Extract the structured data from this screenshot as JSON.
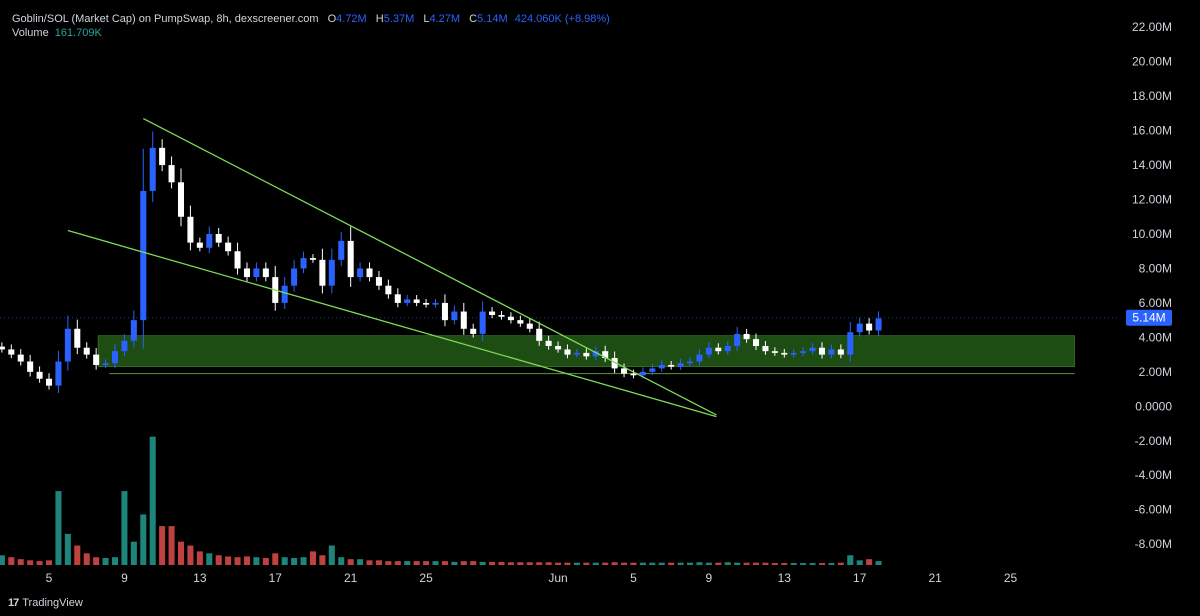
{
  "header": {
    "symbol": "Goblin/SOL (Market Cap) on PumpSwap, 8h, dexscreener.com",
    "o_label": "O",
    "o_value": "4.72M",
    "h_label": "H",
    "h_value": "5.37M",
    "l_label": "L",
    "l_value": "4.27M",
    "c_label": "C",
    "c_value": "5.14M",
    "change": "424.060K (+8.98%)",
    "volume_label": "Volume",
    "volume_value": "161.709K"
  },
  "footer": {
    "brand": "TradingView",
    "logo": "17"
  },
  "colors": {
    "background": "#000000",
    "up": "#2962ff",
    "down": "#ffffff",
    "vol_up": "#26a69a",
    "vol_down": "#ef5350",
    "trendline": "#7ed957",
    "zone_fill": "#1e4d14",
    "last_price_bg": "#2962ff"
  },
  "chart_data": {
    "type": "candlestick",
    "last_price": "5.14M",
    "y_ticks": [
      "22.00M",
      "20.00M",
      "18.00M",
      "16.00M",
      "14.00M",
      "12.00M",
      "10.00M",
      "8.00M",
      "6.00M",
      "4.00M",
      "2.00M",
      "0.0000",
      "-2.00M",
      "-4.00M",
      "-6.00M",
      "-8.00M"
    ],
    "x_ticks": [
      {
        "label": "5",
        "day": 5
      },
      {
        "label": "9",
        "day": 9
      },
      {
        "label": "13",
        "day": 13
      },
      {
        "label": "17",
        "day": 17
      },
      {
        "label": "21",
        "day": 21
      },
      {
        "label": "25",
        "day": 25
      },
      {
        "label": "Jun",
        "day": 32
      },
      {
        "label": "5",
        "day": 36
      },
      {
        "label": "9",
        "day": 40
      },
      {
        "label": "13",
        "day": 44
      },
      {
        "label": "17",
        "day": 48
      },
      {
        "label": "21",
        "day": 52
      },
      {
        "label": "25",
        "day": 56
      }
    ],
    "ylim": [
      -9.5,
      23
    ],
    "xlim": [
      2.4,
      61.7
    ],
    "price_path": [
      [
        2.5,
        3.3
      ],
      [
        3.0,
        3.0
      ],
      [
        3.5,
        2.6
      ],
      [
        4.0,
        2.0
      ],
      [
        4.5,
        1.6
      ],
      [
        5.0,
        1.2
      ],
      [
        5.5,
        2.6
      ],
      [
        6.0,
        4.5
      ],
      [
        6.5,
        3.4
      ],
      [
        7.0,
        3.0
      ],
      [
        7.5,
        2.4
      ],
      [
        8.0,
        2.5
      ],
      [
        8.5,
        3.2
      ],
      [
        9.0,
        3.8
      ],
      [
        9.5,
        5.0
      ],
      [
        10.0,
        12.5
      ],
      [
        10.5,
        15.0
      ],
      [
        11.0,
        14.0
      ],
      [
        11.5,
        13.0
      ],
      [
        12.0,
        11.0
      ],
      [
        12.5,
        9.5
      ],
      [
        13.0,
        9.2
      ],
      [
        13.5,
        10.0
      ],
      [
        14.0,
        9.5
      ],
      [
        14.5,
        9.0
      ],
      [
        15.0,
        8.0
      ],
      [
        15.5,
        7.5
      ],
      [
        16.0,
        8.0
      ],
      [
        16.5,
        7.5
      ],
      [
        17.0,
        6.0
      ],
      [
        17.5,
        7.0
      ],
      [
        18.0,
        8.0
      ],
      [
        18.5,
        8.6
      ],
      [
        19.0,
        8.5
      ],
      [
        19.5,
        7.0
      ],
      [
        20.0,
        8.5
      ],
      [
        20.5,
        9.6
      ],
      [
        21.0,
        7.5
      ],
      [
        21.5,
        8.0
      ],
      [
        22.0,
        7.5
      ],
      [
        22.5,
        7.0
      ],
      [
        23.0,
        6.5
      ],
      [
        23.5,
        6.0
      ],
      [
        24.0,
        6.2
      ],
      [
        24.5,
        6.0
      ],
      [
        25.0,
        5.9
      ],
      [
        25.5,
        6.0
      ],
      [
        26.0,
        5.0
      ],
      [
        26.5,
        5.5
      ],
      [
        27.0,
        4.5
      ],
      [
        27.5,
        4.2
      ],
      [
        28.0,
        5.5
      ],
      [
        28.5,
        5.3
      ],
      [
        29.0,
        5.2
      ],
      [
        29.5,
        5.0
      ],
      [
        30.0,
        4.8
      ],
      [
        30.5,
        4.5
      ],
      [
        31.0,
        3.8
      ],
      [
        31.5,
        3.5
      ],
      [
        32.0,
        3.3
      ],
      [
        32.5,
        3.0
      ],
      [
        33.0,
        3.1
      ],
      [
        33.5,
        2.9
      ],
      [
        34.0,
        3.2
      ],
      [
        34.5,
        2.8
      ],
      [
        35.0,
        2.2
      ],
      [
        35.5,
        1.9
      ],
      [
        36.0,
        1.8
      ],
      [
        36.5,
        2.0
      ],
      [
        37.0,
        2.2
      ],
      [
        37.5,
        2.4
      ],
      [
        38.0,
        2.3
      ],
      [
        38.5,
        2.5
      ],
      [
        39.0,
        2.6
      ],
      [
        39.5,
        3.0
      ],
      [
        40.0,
        3.4
      ],
      [
        40.5,
        3.2
      ],
      [
        41.0,
        3.5
      ],
      [
        41.5,
        4.2
      ],
      [
        42.0,
        3.9
      ],
      [
        42.5,
        3.5
      ],
      [
        43.0,
        3.2
      ],
      [
        43.5,
        3.1
      ],
      [
        44.0,
        3.0
      ],
      [
        44.5,
        3.1
      ],
      [
        45.0,
        3.2
      ],
      [
        45.5,
        3.4
      ],
      [
        46.0,
        3.0
      ],
      [
        46.5,
        3.3
      ],
      [
        47.0,
        3.0
      ],
      [
        47.5,
        4.3
      ],
      [
        48.0,
        4.8
      ],
      [
        48.5,
        4.4
      ],
      [
        49.0,
        5.1
      ]
    ],
    "volume_path": [
      [
        2.5,
        0.25
      ],
      [
        3.0,
        0.2
      ],
      [
        3.5,
        0.15
      ],
      [
        4.0,
        0.12
      ],
      [
        4.5,
        0.1
      ],
      [
        5.0,
        0.12
      ],
      [
        5.5,
        1.9
      ],
      [
        6.0,
        0.8
      ],
      [
        6.5,
        0.5
      ],
      [
        7.0,
        0.3
      ],
      [
        7.5,
        0.2
      ],
      [
        8.0,
        0.18
      ],
      [
        8.5,
        0.2
      ],
      [
        9.0,
        1.9
      ],
      [
        9.5,
        0.6
      ],
      [
        10.0,
        1.3
      ],
      [
        10.5,
        3.3
      ],
      [
        11.0,
        1.0
      ],
      [
        11.5,
        1.0
      ],
      [
        12.0,
        0.6
      ],
      [
        12.5,
        0.5
      ],
      [
        13.0,
        0.35
      ],
      [
        13.5,
        0.3
      ],
      [
        14.0,
        0.25
      ],
      [
        14.5,
        0.22
      ],
      [
        15.0,
        0.2
      ],
      [
        15.5,
        0.22
      ],
      [
        16.0,
        0.2
      ],
      [
        16.5,
        0.18
      ],
      [
        17.0,
        0.3
      ],
      [
        17.5,
        0.2
      ],
      [
        18.0,
        0.18
      ],
      [
        18.5,
        0.2
      ],
      [
        19.0,
        0.35
      ],
      [
        19.5,
        0.25
      ],
      [
        20.0,
        0.5
      ],
      [
        20.5,
        0.2
      ],
      [
        21.0,
        0.15
      ],
      [
        21.5,
        0.15
      ],
      [
        22.0,
        0.12
      ],
      [
        22.5,
        0.12
      ],
      [
        23.0,
        0.1
      ],
      [
        23.5,
        0.1
      ],
      [
        24.0,
        0.1
      ],
      [
        24.5,
        0.1
      ],
      [
        25.0,
        0.1
      ],
      [
        25.5,
        0.1
      ],
      [
        26.0,
        0.1
      ],
      [
        26.5,
        0.08
      ],
      [
        27.0,
        0.1
      ],
      [
        27.5,
        0.1
      ],
      [
        28.0,
        0.08
      ],
      [
        28.5,
        0.08
      ],
      [
        29.0,
        0.08
      ],
      [
        29.5,
        0.07
      ],
      [
        30.0,
        0.07
      ],
      [
        30.5,
        0.07
      ],
      [
        31.0,
        0.07
      ],
      [
        31.5,
        0.07
      ],
      [
        32.0,
        0.06
      ],
      [
        32.5,
        0.06
      ],
      [
        33.0,
        0.06
      ],
      [
        33.5,
        0.06
      ],
      [
        34.0,
        0.06
      ],
      [
        34.5,
        0.06
      ],
      [
        35.0,
        0.07
      ],
      [
        35.5,
        0.06
      ],
      [
        36.0,
        0.06
      ],
      [
        36.5,
        0.06
      ],
      [
        37.0,
        0.06
      ],
      [
        37.5,
        0.06
      ],
      [
        38.0,
        0.06
      ],
      [
        38.5,
        0.06
      ],
      [
        39.0,
        0.06
      ],
      [
        39.5,
        0.07
      ],
      [
        40.0,
        0.06
      ],
      [
        40.5,
        0.06
      ],
      [
        41.0,
        0.07
      ],
      [
        41.5,
        0.06
      ],
      [
        42.0,
        0.06
      ],
      [
        42.5,
        0.06
      ],
      [
        43.0,
        0.06
      ],
      [
        43.5,
        0.05
      ],
      [
        44.0,
        0.05
      ],
      [
        44.5,
        0.05
      ],
      [
        45.0,
        0.05
      ],
      [
        45.5,
        0.05
      ],
      [
        46.0,
        0.05
      ],
      [
        46.5,
        0.05
      ],
      [
        47.0,
        0.06
      ],
      [
        47.5,
        0.25
      ],
      [
        48.0,
        0.12
      ],
      [
        48.5,
        0.15
      ],
      [
        49.0,
        0.1
      ]
    ],
    "volume_ylim": [
      0,
      3.6
    ],
    "trendlines": [
      {
        "name": "upper",
        "x1": 10.0,
        "y1": 16.7,
        "x2": 40.4,
        "y2": -0.5
      },
      {
        "name": "lower",
        "x1": 6.0,
        "y1": 10.2,
        "x2": 40.4,
        "y2": -0.6
      }
    ],
    "support_zone": {
      "x_start": 7.6,
      "x_end": 59.4,
      "y_low": 2.3,
      "y_high": 4.1
    },
    "support_line": {
      "x_start": 8.2,
      "x_end": 59.4,
      "y": 1.9
    },
    "price_line": {
      "y": 5.14
    }
  }
}
